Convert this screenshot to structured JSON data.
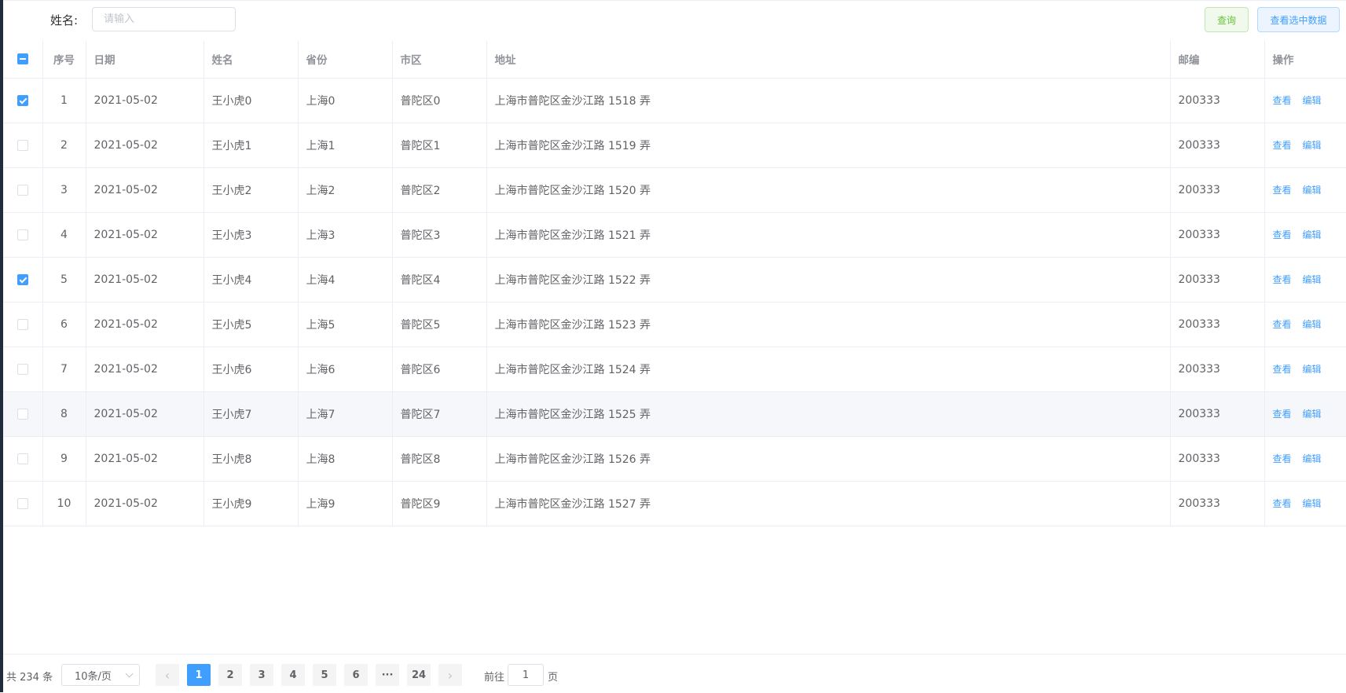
{
  "search": {
    "label": "姓名:",
    "placeholder": "请输入",
    "query_label": "查询",
    "view_selected_label": "查看选中数据"
  },
  "table": {
    "columns": [
      "",
      "序号",
      "日期",
      "姓名",
      "省份",
      "市区",
      "地址",
      "邮编",
      "操作"
    ],
    "action_view": "查看",
    "action_edit": "编辑",
    "header_checkbox_state": "indeterminate",
    "rows": [
      {
        "checked": true,
        "index": "1",
        "date": "2021-05-02",
        "name": "王小虎0",
        "province": "上海0",
        "city": "普陀区0",
        "address": "上海市普陀区金沙江路 1518 弄",
        "zip": "200333"
      },
      {
        "checked": false,
        "index": "2",
        "date": "2021-05-02",
        "name": "王小虎1",
        "province": "上海1",
        "city": "普陀区1",
        "address": "上海市普陀区金沙江路 1519 弄",
        "zip": "200333"
      },
      {
        "checked": false,
        "index": "3",
        "date": "2021-05-02",
        "name": "王小虎2",
        "province": "上海2",
        "city": "普陀区2",
        "address": "上海市普陀区金沙江路 1520 弄",
        "zip": "200333"
      },
      {
        "checked": false,
        "index": "4",
        "date": "2021-05-02",
        "name": "王小虎3",
        "province": "上海3",
        "city": "普陀区3",
        "address": "上海市普陀区金沙江路 1521 弄",
        "zip": "200333"
      },
      {
        "checked": true,
        "index": "5",
        "date": "2021-05-02",
        "name": "王小虎4",
        "province": "上海4",
        "city": "普陀区4",
        "address": "上海市普陀区金沙江路 1522 弄",
        "zip": "200333"
      },
      {
        "checked": false,
        "index": "6",
        "date": "2021-05-02",
        "name": "王小虎5",
        "province": "上海5",
        "city": "普陀区5",
        "address": "上海市普陀区金沙江路 1523 弄",
        "zip": "200333"
      },
      {
        "checked": false,
        "index": "7",
        "date": "2021-05-02",
        "name": "王小虎6",
        "province": "上海6",
        "city": "普陀区6",
        "address": "上海市普陀区金沙江路 1524 弄",
        "zip": "200333"
      },
      {
        "checked": false,
        "index": "8",
        "date": "2021-05-02",
        "name": "王小虎7",
        "province": "上海7",
        "city": "普陀区7",
        "address": "上海市普陀区金沙江路 1525 弄",
        "zip": "200333",
        "hover": true
      },
      {
        "checked": false,
        "index": "9",
        "date": "2021-05-02",
        "name": "王小虎8",
        "province": "上海8",
        "city": "普陀区8",
        "address": "上海市普陀区金沙江路 1526 弄",
        "zip": "200333"
      },
      {
        "checked": false,
        "index": "10",
        "date": "2021-05-02",
        "name": "王小虎9",
        "province": "上海9",
        "city": "普陀区9",
        "address": "上海市普陀区金沙江路 1527 弄",
        "zip": "200333"
      }
    ]
  },
  "pagination": {
    "total_text": "共 234 条",
    "page_size": "10条/页",
    "prev_icon": "‹",
    "next_icon": "›",
    "pages": [
      "1",
      "2",
      "3",
      "4",
      "5",
      "6",
      "···",
      "24"
    ],
    "current_page": "1",
    "goto_label": "前往",
    "goto_value": "1",
    "goto_suffix": "页"
  },
  "colors": {
    "primary": "#409eff",
    "success": "#67c23a",
    "border": "#ebeef5"
  }
}
